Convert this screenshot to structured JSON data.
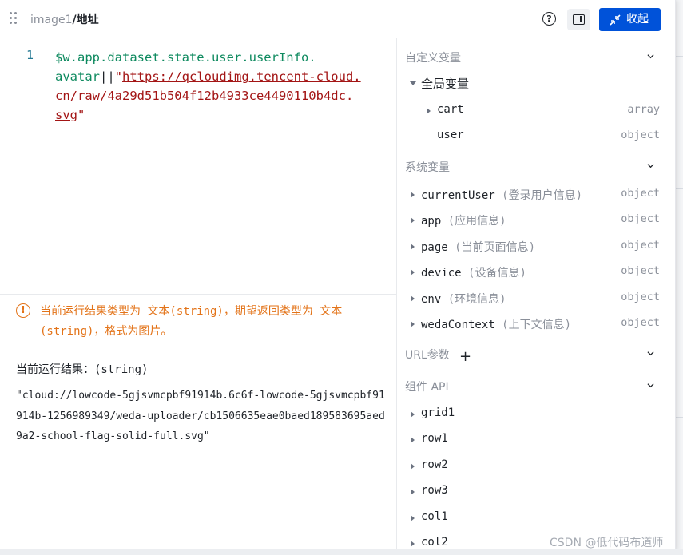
{
  "header": {
    "breadcrumb_parent": "image1",
    "breadcrumb_current": "/地址",
    "help_glyph": "?",
    "collapse_label": "收起"
  },
  "editor": {
    "line_number": "1",
    "code_var_line1": "$w.app.dataset.state.user.userInfo.",
    "code_var_line2": "avatar",
    "code_op": "||",
    "code_quote_open": "\"",
    "code_url_line2": "https://qcloudimg.tencent-cloud.",
    "code_url_line3": "cn/raw/4a29d51b504f12b4933ce4490110b4dc.",
    "code_url_line4": "svg",
    "code_quote_close": "\""
  },
  "result": {
    "warning_icon": "!",
    "warning_text": "当前运行结果类型为 文本(string)，期望返回类型为 文本(string)，格式为图片。",
    "label": "当前运行结果：(string)",
    "value": "\"cloud://lowcode-5gjsvmcpbf91914b.6c6f-lowcode-5gjsvmcpbf91914b-1256989349/weda-uploader/cb1506635eae0baed189583695aed9a2-school-flag-solid-full.svg\""
  },
  "sidebar": {
    "custom_vars_title": "自定义变量",
    "global_vars_label": "全局变量",
    "global_items": [
      {
        "name": "cart",
        "type": "array"
      },
      {
        "name": "user",
        "type": "object"
      }
    ],
    "system_vars_title": "系统变量",
    "system_items": [
      {
        "name": "currentUser",
        "desc": "(登录用户信息)",
        "type": "object"
      },
      {
        "name": "app",
        "desc": "(应用信息)",
        "type": "object"
      },
      {
        "name": "page",
        "desc": "(当前页面信息)",
        "type": "object"
      },
      {
        "name": "device",
        "desc": "(设备信息)",
        "type": "object"
      },
      {
        "name": "env",
        "desc": "(环境信息)",
        "type": "object"
      },
      {
        "name": "wedaContext",
        "desc": "(上下文信息)",
        "type": "object"
      }
    ],
    "url_params_title": "URL参数",
    "url_params_add": "+",
    "component_api_title": "组件 API",
    "component_items": [
      "grid1",
      "row1",
      "row2",
      "row3",
      "col1",
      "col2"
    ]
  },
  "watermark": "CSDN @低代码布道师",
  "colors": {
    "primary": "#0052d9",
    "warning": "#e37318",
    "code_var": "#0e8a5f",
    "code_string": "#a31515"
  },
  "icons": [
    "drag-handle-icon",
    "help-circle-icon",
    "panel-toggle-icon",
    "collapse-icon",
    "warning-circle-icon",
    "chevron-down-icon",
    "caret-right-icon",
    "caret-down-icon",
    "plus-icon"
  ]
}
